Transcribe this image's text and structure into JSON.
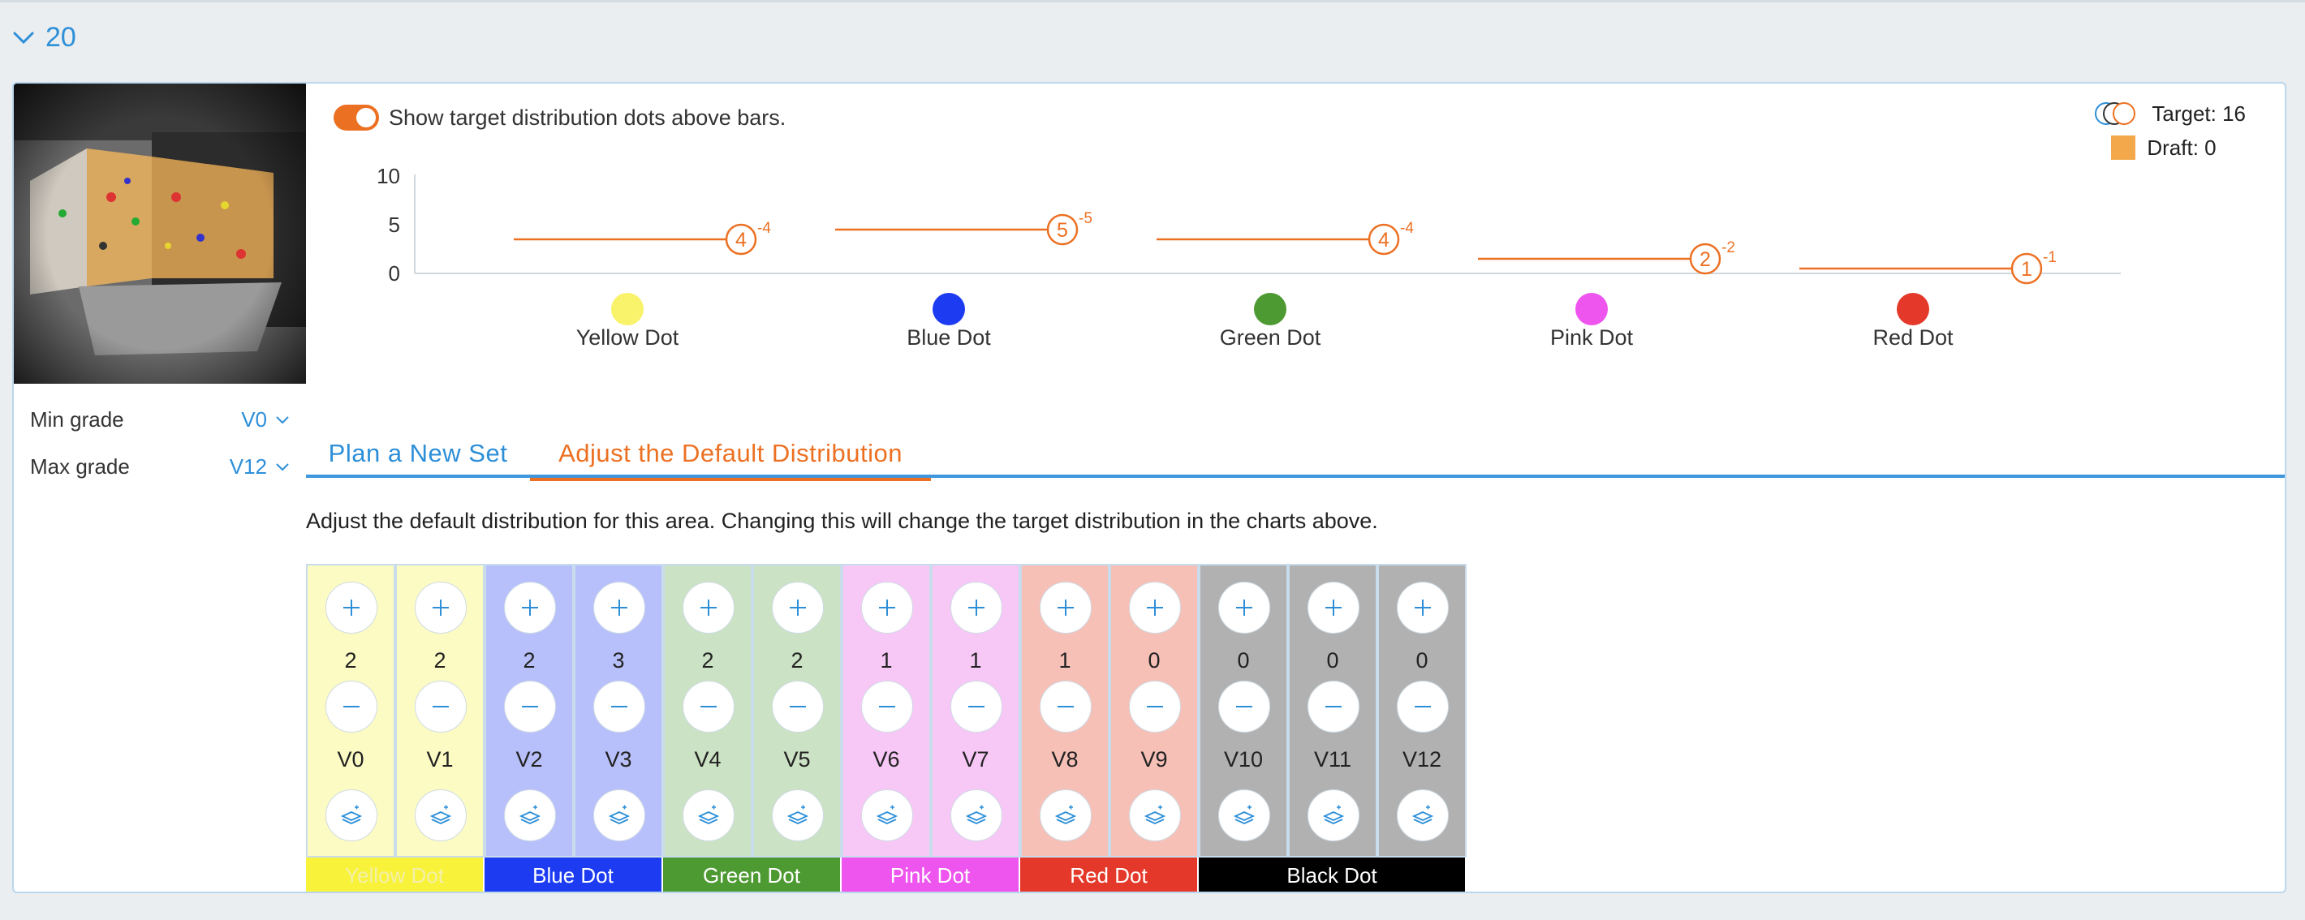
{
  "section": {
    "number": "20"
  },
  "grades": {
    "min_label": "Min grade",
    "min_value": "V0",
    "max_label": "Max grade",
    "max_value": "V12"
  },
  "toggle": {
    "label": "Show target distribution dots above bars.",
    "on": true
  },
  "legend": {
    "target_label": "Target: 16",
    "draft_label": "Draft: 0",
    "draft_color": "#f3a84c"
  },
  "chart_data": {
    "type": "bar",
    "categories": [
      "Yellow Dot",
      "Blue Dot",
      "Green Dot",
      "Pink Dot",
      "Red Dot"
    ],
    "category_colors": [
      "#f8f36a",
      "#1d3cf2",
      "#4e9a32",
      "#ee55ee",
      "#e4392a"
    ],
    "series": [
      {
        "name": "Target",
        "values": [
          4,
          5,
          4,
          2,
          1
        ]
      },
      {
        "name": "Draft",
        "values": [
          0,
          0,
          0,
          0,
          0
        ]
      }
    ],
    "deltas": [
      "-4",
      "-5",
      "-4",
      "-2",
      "-1"
    ],
    "yticks": [
      "10",
      "5",
      "0"
    ],
    "ylim": [
      0,
      10
    ],
    "target_color": "#ec7022"
  },
  "tabs": [
    {
      "label": "Plan a New Set",
      "active": false
    },
    {
      "label": "Adjust the Default Distribution",
      "active": true
    }
  ],
  "description": "Adjust the default distribution for this area. Changing this will change the target distribution in the charts above.",
  "grade_columns": [
    {
      "grade": "V0",
      "count": "2",
      "color": "#fdfbc4"
    },
    {
      "grade": "V1",
      "count": "2",
      "color": "#fdfbc4"
    },
    {
      "grade": "V2",
      "count": "2",
      "color": "#b8c0fb"
    },
    {
      "grade": "V3",
      "count": "3",
      "color": "#b8c0fb"
    },
    {
      "grade": "V4",
      "count": "2",
      "color": "#cce2c4"
    },
    {
      "grade": "V5",
      "count": "2",
      "color": "#cce2c4"
    },
    {
      "grade": "V6",
      "count": "1",
      "color": "#f7c8f6"
    },
    {
      "grade": "V7",
      "count": "1",
      "color": "#f7c8f6"
    },
    {
      "grade": "V8",
      "count": "1",
      "color": "#f6c0b7"
    },
    {
      "grade": "V9",
      "count": "0",
      "color": "#f6c0b7"
    },
    {
      "grade": "V10",
      "count": "0",
      "color": "#b1b1b1"
    },
    {
      "grade": "V11",
      "count": "0",
      "color": "#b1b1b1"
    },
    {
      "grade": "V12",
      "count": "0",
      "color": "#b1b1b1"
    }
  ],
  "color_bands": [
    {
      "label": "Yellow Dot",
      "color": "#f8f33a",
      "text_color": "#f3f0a8",
      "span": 2
    },
    {
      "label": "Blue Dot",
      "color": "#1d3cf2",
      "text_color": "#ffffff",
      "span": 2
    },
    {
      "label": "Green Dot",
      "color": "#4e9a32",
      "text_color": "#ffffff",
      "span": 2
    },
    {
      "label": "Pink Dot",
      "color": "#ee55ee",
      "text_color": "#ffffff",
      "span": 2
    },
    {
      "label": "Red Dot",
      "color": "#e4392a",
      "text_color": "#ffffff",
      "span": 2
    },
    {
      "label": "Black Dot",
      "color": "#000000",
      "text_color": "#ffffff",
      "span": 3
    }
  ]
}
